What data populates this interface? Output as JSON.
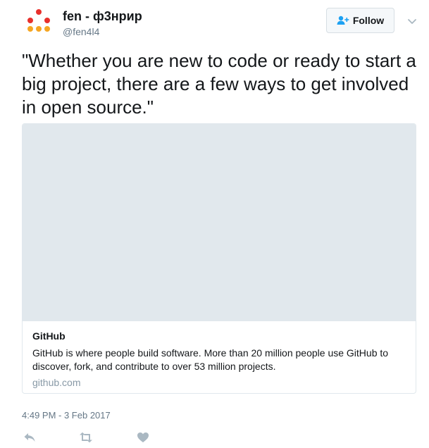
{
  "author": {
    "name": "fen - ф3нрир",
    "handle": "@fen4l4"
  },
  "follow_button": {
    "label": "Follow",
    "icon": "add-person-icon"
  },
  "menu": {
    "icon": "chevron-down-icon"
  },
  "tweet": {
    "text": "\"Whether you are new to code or ready to start a big project, there are a few ways to get involved in open source.\"",
    "timestamp": "4:49 PM - 3 Feb 2017"
  },
  "card": {
    "title": "GitHub",
    "description": "GitHub is where people build software. More than 20 million people use GitHub to discover, fork, and contribute to over 53 million projects.",
    "domain": "github.com"
  },
  "actions": [
    {
      "icon": "reply-icon"
    },
    {
      "icon": "retweet-icon"
    },
    {
      "icon": "like-icon"
    }
  ],
  "colors": {
    "text": "#14171a",
    "secondary": "#657786",
    "accent": "#1da1f2",
    "card_border": "#e1e8ed",
    "avatar_red": "#e8302c",
    "avatar_orange": "#f5a623"
  }
}
